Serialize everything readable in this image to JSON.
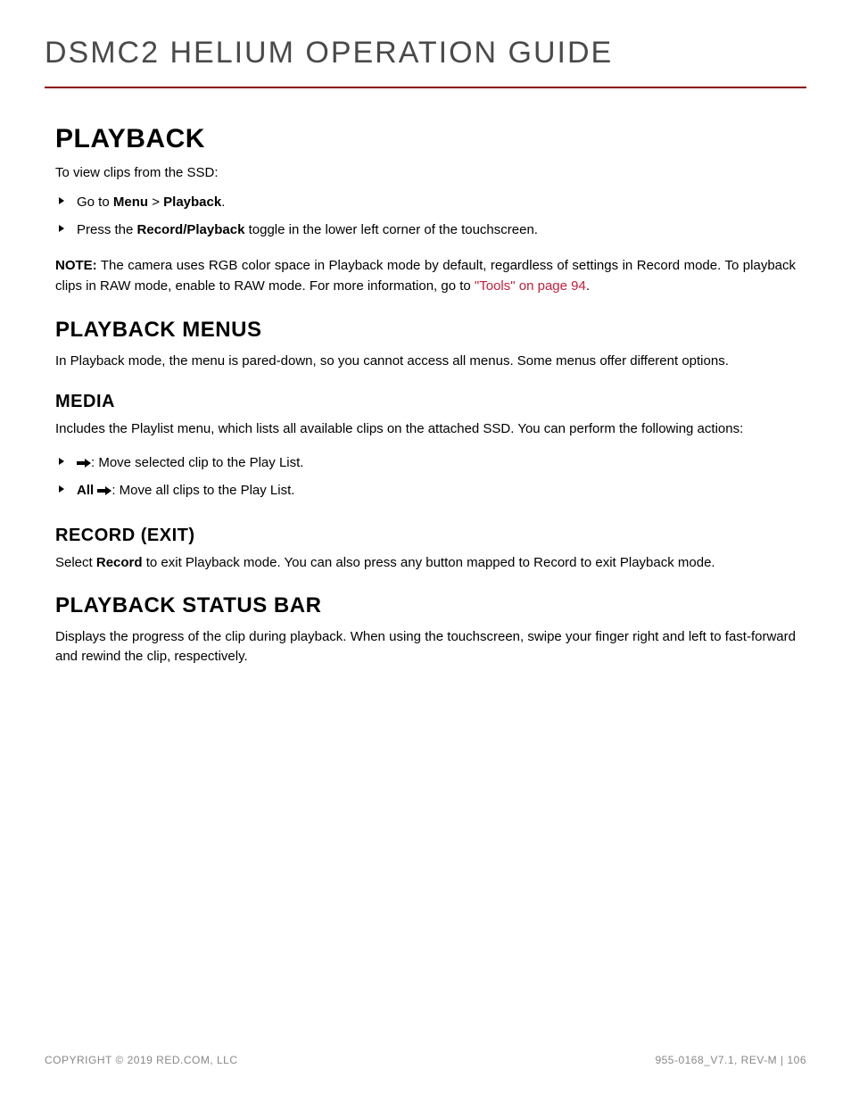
{
  "header": {
    "title": "DSMC2 HELIUM OPERATION GUIDE"
  },
  "section": {
    "title": "PLAYBACK",
    "intro": "To view clips from the SSD:",
    "bullets": {
      "goto_prefix": "Go to ",
      "menu": "Menu",
      "gt": " > ",
      "playback": "Playback",
      "period": ".",
      "press_prefix": "Press the ",
      "record_playback": "Record/Playback",
      "press_suffix": " toggle in the lower left corner of the touchscreen."
    },
    "note": {
      "label": "NOTE:",
      "text": " The camera uses RGB color space in Playback mode by default, regardless of settings in Record mode. To playback clips in RAW mode, enable to RAW mode. For more information, go to ",
      "link": "\"Tools\" on page 94",
      "end": "."
    }
  },
  "playback_menus": {
    "title": "PLAYBACK MENUS",
    "text": "In Playback mode, the menu is pared-down, so you cannot access all menus. Some menus offer different options."
  },
  "media": {
    "title": "MEDIA",
    "text": "Includes the Playlist menu, which lists all available clips on the attached SSD. You can perform the following actions:",
    "bullet1_suffix": ": Move selected clip to the Play List.",
    "bullet2_all": "All",
    "bullet2_suffix": ": Move all clips to the Play List."
  },
  "record_exit": {
    "title": "RECORD (EXIT)",
    "select": "Select ",
    "record": "Record",
    "suffix": " to exit Playback mode. You can also press any button mapped to Record to exit Playback mode."
  },
  "status_bar": {
    "title": "PLAYBACK STATUS BAR",
    "text": "Displays the progress of the clip during playback. When using the touchscreen, swipe your finger right and left to fast-forward and rewind the clip, respectively."
  },
  "footer": {
    "copyright": "COPYRIGHT © 2019 RED.COM, LLC",
    "docinfo": "955-0168_V7.1, REV-M  |  106"
  }
}
